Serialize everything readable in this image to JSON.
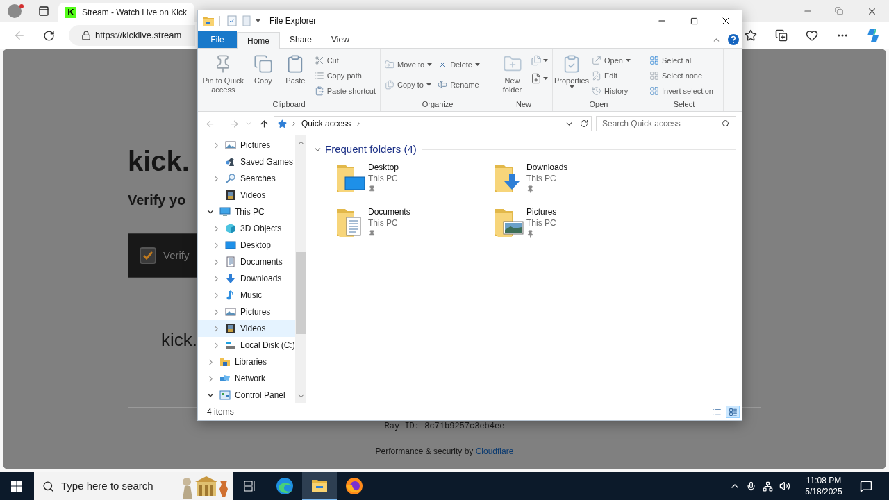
{
  "browser": {
    "favicon_text": "K",
    "tab_title": "Stream - Watch Live on Kick",
    "address": "https://kicklive.stream"
  },
  "page": {
    "heading": "kick.",
    "subheading": "Verify yo",
    "verify": {
      "label": "Verify",
      "checked": true
    },
    "domain": "kick.",
    "ray_id": "Ray ID: 8c71b9257c3eb4ee",
    "footer": {
      "text": "Performance & security by ",
      "link": "Cloudflare"
    }
  },
  "explorer": {
    "title": "File Explorer",
    "ribbon_tabs": [
      {
        "label": "File",
        "kind": "file",
        "selected": false
      },
      {
        "label": "Home",
        "kind": "tab",
        "selected": true
      },
      {
        "label": "Share",
        "kind": "tab",
        "selected": false
      },
      {
        "label": "View",
        "kind": "tab",
        "selected": false
      }
    ],
    "ribbon_groups": [
      {
        "label": "Clipboard",
        "columns": [
          {
            "kind": "large",
            "items": [
              {
                "label": "Pin to Quick access",
                "dropdown": false
              }
            ]
          },
          {
            "kind": "large",
            "items": [
              {
                "label": "Copy",
                "dropdown": false
              }
            ]
          },
          {
            "kind": "large",
            "items": [
              {
                "label": "Paste",
                "dropdown": false
              }
            ]
          },
          {
            "kind": "stack",
            "items": [
              {
                "label": "Cut",
                "dropdown": false
              },
              {
                "label": "Copy path",
                "dropdown": false
              },
              {
                "label": "Paste shortcut",
                "dropdown": false
              }
            ]
          }
        ]
      },
      {
        "label": "Organize",
        "columns": [
          {
            "kind": "stack",
            "items": [
              {
                "label": "Move to",
                "dropdown": true
              },
              {
                "label": "Copy to",
                "dropdown": true
              }
            ]
          },
          {
            "kind": "stack",
            "items": [
              {
                "label": "Delete",
                "dropdown": true
              },
              {
                "label": "Rename",
                "dropdown": false
              }
            ]
          }
        ]
      },
      {
        "label": "New",
        "columns": [
          {
            "kind": "large",
            "items": [
              {
                "label": "New folder",
                "dropdown": false
              }
            ]
          },
          {
            "kind": "icons",
            "items": [
              {
                "dropdown": true
              },
              {
                "dropdown": true
              }
            ]
          }
        ]
      },
      {
        "label": "Open",
        "columns": [
          {
            "kind": "large",
            "items": [
              {
                "label": "Properties",
                "dropdown": true
              }
            ]
          },
          {
            "kind": "stack",
            "items": [
              {
                "label": "Open",
                "dropdown": true
              },
              {
                "label": "Edit",
                "dropdown": false
              },
              {
                "label": "History",
                "dropdown": false
              }
            ]
          }
        ]
      },
      {
        "label": "Select",
        "columns": [
          {
            "kind": "stack",
            "items": [
              {
                "label": "Select all",
                "dropdown": false
              },
              {
                "label": "Select none",
                "dropdown": false
              },
              {
                "label": "Invert selection",
                "dropdown": false
              }
            ]
          }
        ]
      }
    ],
    "breadcrumb": [
      "Quick access"
    ],
    "search_placeholder": "Search Quick access",
    "nav_items_above": [
      {
        "label": "Pictures",
        "kind": "pictures",
        "expandable": true,
        "expanded": false,
        "selected": false
      },
      {
        "label": "Saved Games",
        "kind": "games",
        "expandable": false,
        "selected": false
      },
      {
        "label": "Searches",
        "kind": "search",
        "expandable": true,
        "expanded": false,
        "selected": false
      },
      {
        "label": "Videos",
        "kind": "videos",
        "expandable": false,
        "selected": false
      }
    ],
    "nav_items": [
      {
        "label": "This PC",
        "kind": "pc",
        "expandable": true,
        "expanded": true,
        "selected": false,
        "children": [
          {
            "label": "3D Objects",
            "kind": "objects3d",
            "expandable": true,
            "expanded": false,
            "selected": false
          },
          {
            "label": "Desktop",
            "kind": "desktop",
            "expandable": true,
            "expanded": false,
            "selected": false
          },
          {
            "label": "Documents",
            "kind": "documents",
            "expandable": true,
            "expanded": false,
            "selected": false
          },
          {
            "label": "Downloads",
            "kind": "downloads",
            "expandable": true,
            "expanded": false,
            "selected": false
          },
          {
            "label": "Music",
            "kind": "music",
            "expandable": true,
            "expanded": false,
            "selected": false
          },
          {
            "label": "Pictures",
            "kind": "pictures",
            "expandable": true,
            "expanded": false,
            "selected": false
          },
          {
            "label": "Videos",
            "kind": "videos",
            "expandable": true,
            "expanded": false,
            "selected": true
          },
          {
            "label": "Local Disk (C:)",
            "kind": "disk",
            "expandable": true,
            "expanded": false,
            "selected": false
          }
        ]
      },
      {
        "label": "Libraries",
        "kind": "libraries",
        "expandable": true,
        "expanded": false,
        "selected": false
      },
      {
        "label": "Network",
        "kind": "network",
        "expandable": true,
        "expanded": false,
        "selected": false
      },
      {
        "label": "Control Panel",
        "kind": "control",
        "expandable": true,
        "expanded": true,
        "selected": false
      }
    ],
    "group": {
      "title": "Frequent folders (4)",
      "expanded": true,
      "folders": [
        {
          "name": "Desktop",
          "location": "This PC",
          "kind": "desktop",
          "pinned": true
        },
        {
          "name": "Downloads",
          "location": "This PC",
          "kind": "downloads",
          "pinned": true
        },
        {
          "name": "Documents",
          "location": "This PC",
          "kind": "documents",
          "pinned": true
        },
        {
          "name": "Pictures",
          "location": "This PC",
          "kind": "pictures",
          "pinned": true
        }
      ]
    },
    "status": "4 items",
    "views": [
      {
        "kind": "details",
        "selected": false
      },
      {
        "kind": "large",
        "selected": true
      }
    ]
  },
  "taskbar": {
    "search_placeholder": "Type here to search",
    "apps": [
      {
        "kind": "taskview",
        "selected": false
      },
      {
        "kind": "edge",
        "selected": false
      },
      {
        "kind": "explorer",
        "selected": true
      },
      {
        "kind": "firefox",
        "selected": false
      }
    ],
    "time": "11:08 PM",
    "date": "5/18/2025"
  }
}
